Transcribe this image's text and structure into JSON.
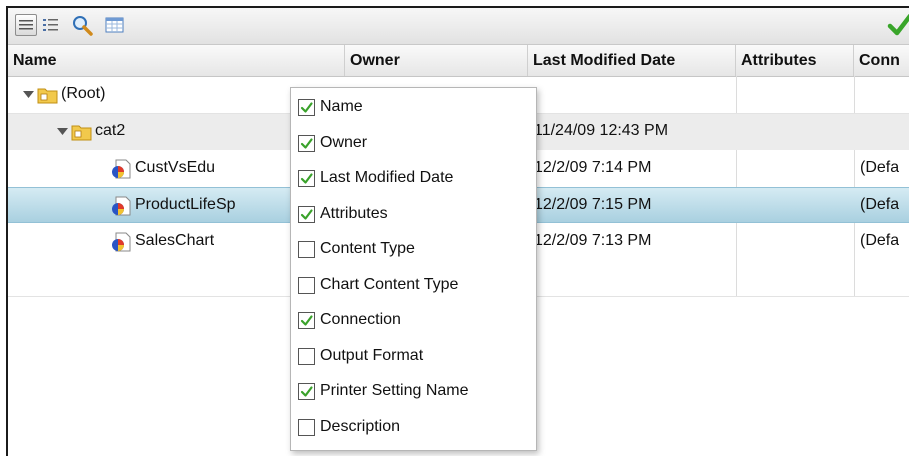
{
  "toolbar": {
    "icons": [
      "list-view-icon",
      "details-view-icon",
      "search-icon",
      "table-icon",
      "checkmark-icon"
    ],
    "colors": {
      "check": "#39a52a",
      "search": "#2f6fb6"
    }
  },
  "columns": [
    "Name",
    "Owner",
    "Last Modified Date",
    "Attributes",
    "Conn"
  ],
  "rows": [
    {
      "name": "(Root)",
      "date": "",
      "conn": ""
    },
    {
      "name": "cat2",
      "date": "11/24/09 12:43 PM",
      "conn": ""
    },
    {
      "name": "CustVsEdu",
      "date": "12/2/09 7:14 PM",
      "conn": "(Defa"
    },
    {
      "name": "ProductLifeSp",
      "date": "12/2/09 7:15 PM",
      "conn": "(Defa"
    },
    {
      "name": "SalesChart",
      "date": "12/2/09 7:13 PM",
      "conn": "(Defa"
    }
  ],
  "menu": {
    "items": [
      {
        "label": "Name",
        "checked": true
      },
      {
        "label": "Owner",
        "checked": true
      },
      {
        "label": "Last Modified Date",
        "checked": true
      },
      {
        "label": "Attributes",
        "checked": true
      },
      {
        "label": "Content Type",
        "checked": false
      },
      {
        "label": "Chart Content Type",
        "checked": false
      },
      {
        "label": "Connection",
        "checked": true
      },
      {
        "label": "Output Format",
        "checked": false
      },
      {
        "label": "Printer Setting Name",
        "checked": true
      },
      {
        "label": "Description",
        "checked": false
      }
    ]
  },
  "colors": {
    "selected_row": "#b9dbe8",
    "folder": "#e8b830",
    "checkmark": "#3aa22b"
  }
}
